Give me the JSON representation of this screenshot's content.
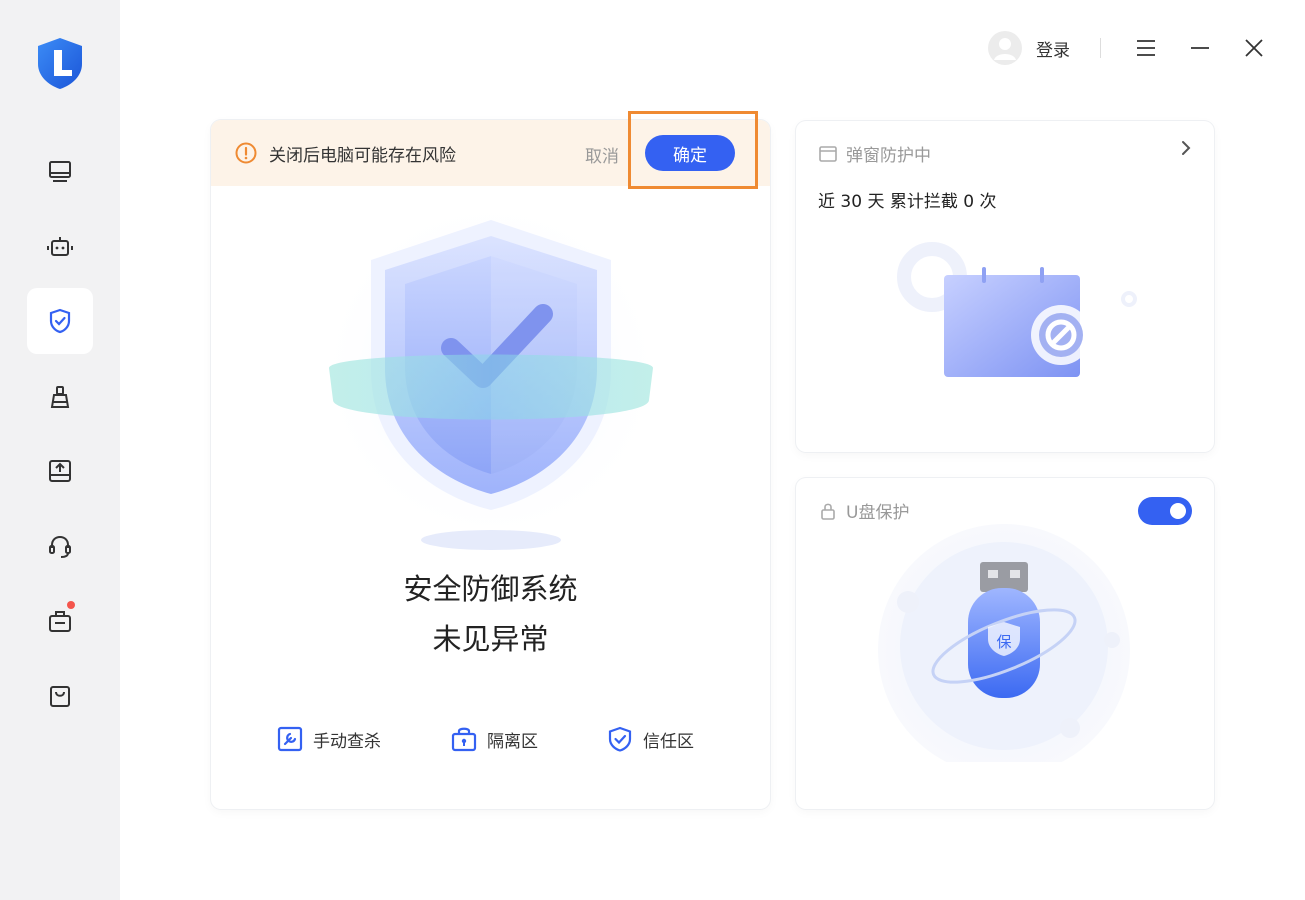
{
  "topbar": {
    "login_label": "登录",
    "icons": [
      "avatar-icon",
      "menu-icon",
      "minimize-icon",
      "close-icon"
    ]
  },
  "sidebar": {
    "logo": "app-logo-shield-icon",
    "items": [
      {
        "icon": "monitor-icon",
        "active": false
      },
      {
        "icon": "robot-icon",
        "active": false
      },
      {
        "icon": "shield-check-icon",
        "active": true
      },
      {
        "icon": "broom-icon",
        "active": false
      },
      {
        "icon": "disk-upload-icon",
        "active": false
      },
      {
        "icon": "headset-icon",
        "active": false
      },
      {
        "icon": "toolbox-icon",
        "active": false,
        "badge": true
      },
      {
        "icon": "shopping-bag-icon",
        "active": false
      }
    ]
  },
  "main": {
    "warning": {
      "text": "关闭后电脑可能存在风险",
      "cancel_label": "取消",
      "confirm_label": "确定"
    },
    "status_line1": "安全防御系统",
    "status_line2": "未见异常",
    "tools": [
      {
        "label": "手动查杀",
        "icon": "manual-scan-icon"
      },
      {
        "label": "隔离区",
        "icon": "quarantine-icon"
      },
      {
        "label": "信任区",
        "icon": "trust-zone-icon"
      }
    ]
  },
  "popup_card": {
    "title": "弹窗防护中",
    "stat": "近 30 天 累计拦截 0 次"
  },
  "usb_card": {
    "title": "U盘保护",
    "toggle_on": true,
    "usb_badge": "保"
  },
  "colors": {
    "accent": "#3461f2",
    "warning_bg": "#fdf3e8",
    "highlight": "#ef8a32",
    "sidebar_bg": "#f2f2f3"
  }
}
